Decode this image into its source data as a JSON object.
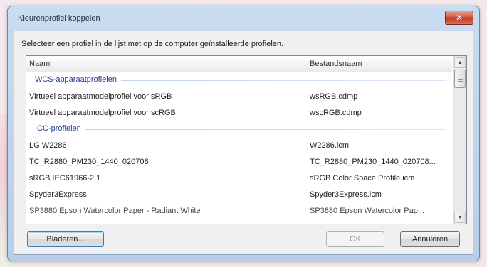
{
  "window": {
    "title": "Kleurenprofiel koppelen",
    "close_glyph": "✕"
  },
  "instruction": "Selecteer een profiel in de lijst met op de computer geïnstalleerde profielen.",
  "list": {
    "headers": {
      "name": "Naam",
      "file": "Bestandsnaam"
    },
    "groups": [
      {
        "label": "WCS-apparaatprofielen",
        "rows": [
          {
            "name": "Virtueel apparaatmodelprofiel voor sRGB",
            "file": "wsRGB.cdmp"
          },
          {
            "name": "Virtueel apparaatmodelprofiel voor scRGB",
            "file": "wscRGB.cdmp"
          }
        ]
      },
      {
        "label": "ICC-profielen",
        "rows": [
          {
            "name": "LG W2286",
            "file": "W2286.icm"
          },
          {
            "name": "TC_R2880_PM230_1440_020708",
            "file": "TC_R2880_PM230_1440_020708..."
          },
          {
            "name": "sRGB IEC61966-2.1",
            "file": "sRGB Color Space Profile.icm"
          },
          {
            "name": "Spyder3Express",
            "file": "Spyder3Express.icm"
          },
          {
            "name": "SP3880 Epson Watercolor Paper - Radiant White",
            "file": "SP3880 Epson Watercolor Pap..."
          }
        ]
      }
    ]
  },
  "scrollbar": {
    "up_glyph": "▲",
    "down_glyph": "▼"
  },
  "buttons": {
    "browse": "Bladeren...",
    "ok": "OK",
    "cancel": "Annuleren"
  }
}
